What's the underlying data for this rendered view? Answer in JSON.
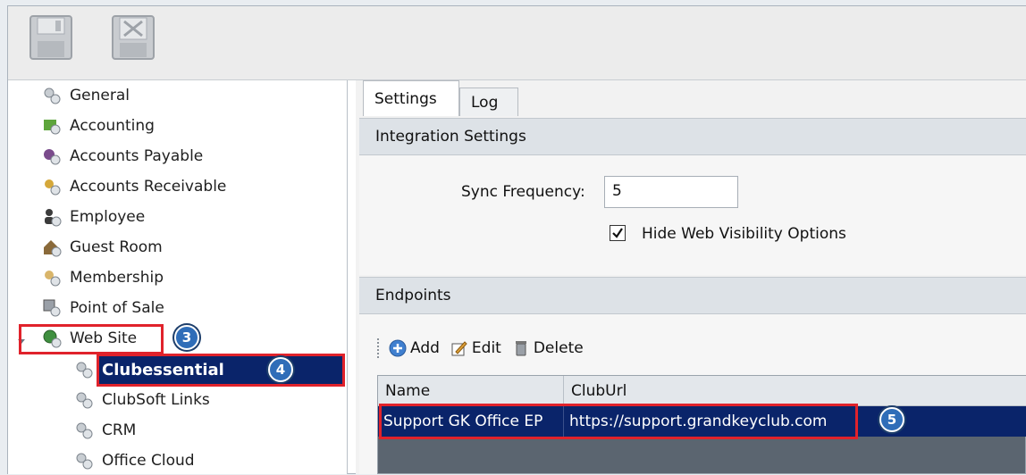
{
  "toolbar": {
    "save_icon": "floppy-disk-icon",
    "close_icon": "close-document-icon"
  },
  "tree": {
    "items": [
      {
        "label": "General",
        "icon": "gears-icon"
      },
      {
        "label": "Accounting",
        "icon": "accounting-icon"
      },
      {
        "label": "Accounts Payable",
        "icon": "accounts-payable-icon"
      },
      {
        "label": "Accounts Receivable",
        "icon": "accounts-receivable-icon"
      },
      {
        "label": "Employee",
        "icon": "employee-icon"
      },
      {
        "label": "Guest Room",
        "icon": "house-icon"
      },
      {
        "label": "Membership",
        "icon": "membership-icon"
      },
      {
        "label": "Point of Sale",
        "icon": "point-of-sale-icon"
      },
      {
        "label": "Web Site",
        "icon": "globe-gear-icon"
      },
      {
        "label": "Clubessential",
        "icon": "gears-icon"
      },
      {
        "label": "ClubSoft Links",
        "icon": "gears-icon"
      },
      {
        "label": "CRM",
        "icon": "gears-icon"
      },
      {
        "label": "Office Cloud",
        "icon": "gears-icon"
      }
    ]
  },
  "tabs": [
    {
      "label": "Settings"
    },
    {
      "label": "Log"
    }
  ],
  "integration": {
    "header": "Integration Settings",
    "sync_label": "Sync Frequency:",
    "sync_value": "5",
    "hide_web_label": "Hide Web Visibility Options",
    "hide_web_checked": true
  },
  "endpoints": {
    "header": "Endpoints",
    "actions": {
      "add": "Add",
      "edit": "Edit",
      "delete": "Delete"
    },
    "columns": [
      "Name",
      "ClubUrl"
    ],
    "rows": [
      {
        "name": "Support GK Office EP",
        "url": "https://support.grandkeyclub.com"
      }
    ]
  },
  "callouts": {
    "c3": "3",
    "c4": "4",
    "c5": "5"
  },
  "colors": {
    "selection": "#0a246a",
    "callout_border": "#e0222b",
    "badge": "#2f6db8"
  }
}
